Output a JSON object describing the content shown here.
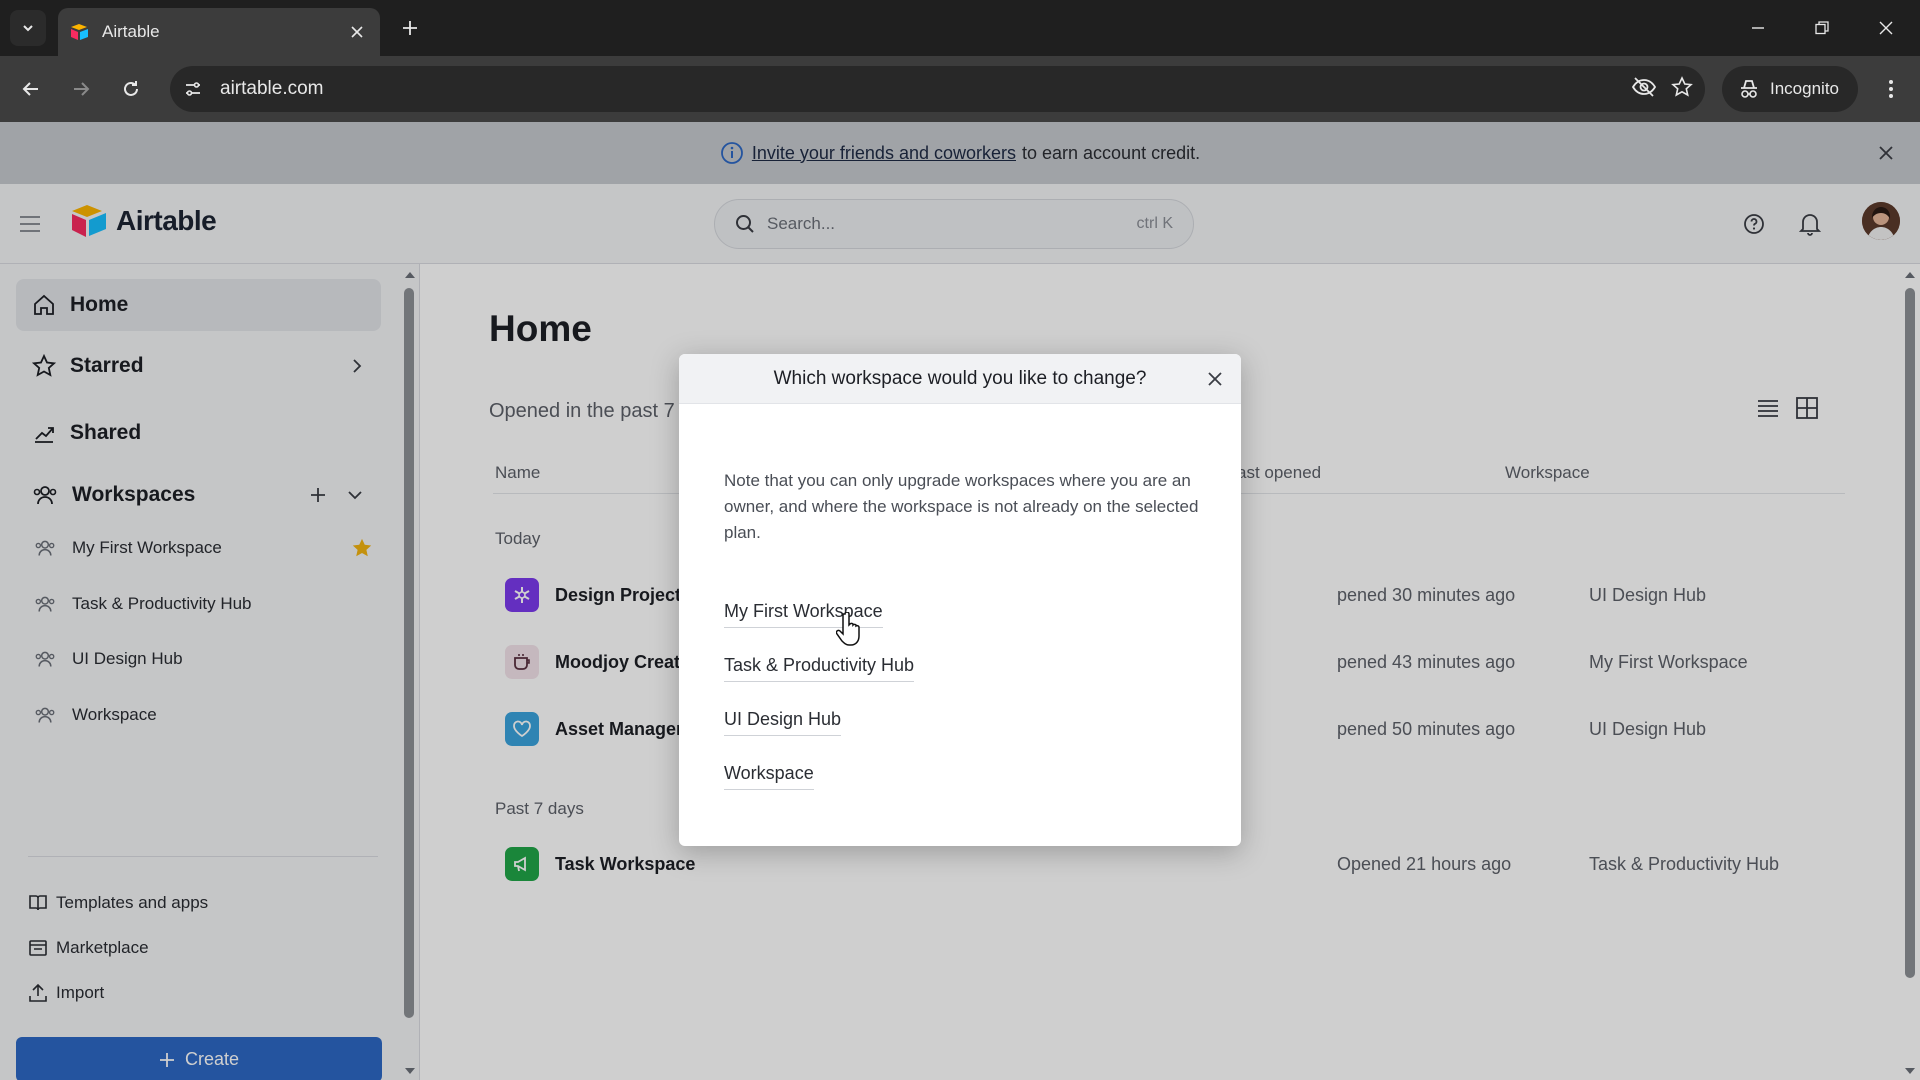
{
  "browser": {
    "tab_title": "Airtable",
    "url": "airtable.com",
    "incognito_label": "Incognito"
  },
  "banner": {
    "link_text": "Invite your friends and coworkers",
    "rest_text": "to earn account credit."
  },
  "header": {
    "logo_text": "Airtable",
    "search_placeholder": "Search...",
    "search_shortcut": "ctrl K"
  },
  "sidebar": {
    "nav": [
      {
        "label": "Home",
        "icon": "home-icon"
      },
      {
        "label": "Starred",
        "icon": "star-icon"
      },
      {
        "label": "Shared",
        "icon": "shared-icon"
      },
      {
        "label": "Workspaces",
        "icon": "workspaces-icon"
      }
    ],
    "workspaces": [
      {
        "label": "My First Workspace",
        "starred": true
      },
      {
        "label": "Task & Productivity Hub"
      },
      {
        "label": "UI Design Hub"
      },
      {
        "label": "Workspace"
      }
    ],
    "links": [
      {
        "label": "Templates and apps",
        "icon": "book-icon"
      },
      {
        "label": "Marketplace",
        "icon": "marketplace-icon"
      },
      {
        "label": "Import",
        "icon": "upload-icon"
      }
    ],
    "create_label": "Create"
  },
  "main": {
    "title": "Home",
    "filter_label": "Opened in the past 7",
    "columns": {
      "name": "Name",
      "last_opened": "ast opened",
      "workspace": "Workspace"
    },
    "sections": [
      {
        "label": "Today",
        "rows": [
          {
            "name": "Design Project",
            "opened": "pened 30 minutes ago",
            "workspace": "UI Design Hub",
            "icon": "asterisk-icon",
            "color": "#7c3aed"
          },
          {
            "name": "Moodjoy Creat",
            "opened": "pened 43 minutes ago",
            "workspace": "My First Workspace",
            "icon": "cup-icon",
            "color": "#f3e3ea"
          },
          {
            "name": "Asset Manager",
            "opened": "pened 50 minutes ago",
            "workspace": "UI Design Hub",
            "icon": "heart-icon",
            "color": "#3aa3dd"
          }
        ]
      },
      {
        "label": "Past 7 days",
        "rows": [
          {
            "name": "Task Workspace",
            "opened": "Opened 21 hours ago",
            "workspace": "Task & Productivity Hub",
            "icon": "megaphone-icon",
            "color": "#20a548"
          }
        ]
      }
    ]
  },
  "modal": {
    "title": "Which workspace would you like to change?",
    "note": "Note that you can only upgrade workspaces where you are an owner, and where the workspace is not already on the selected plan.",
    "options": [
      "My First Workspace",
      "Task & Productivity Hub",
      "UI Design Hub",
      "Workspace"
    ]
  },
  "colors": {
    "accent": "#2d68c4",
    "star": "#f2b311"
  }
}
